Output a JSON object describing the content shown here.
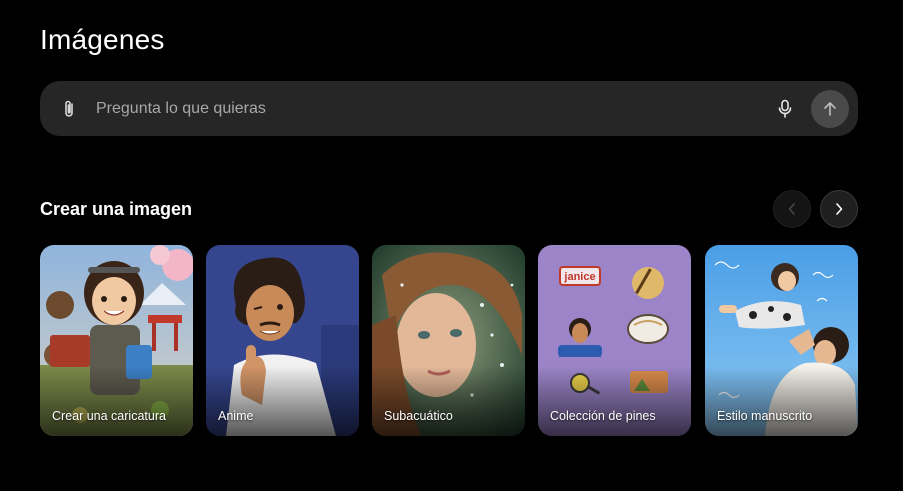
{
  "page": {
    "title": "Imágenes"
  },
  "prompt": {
    "placeholder": "Pregunta lo que quieras",
    "value": "",
    "attach_icon": "paperclip-icon",
    "mic_icon": "microphone-icon",
    "send_icon": "arrow-up-icon"
  },
  "section": {
    "title": "Crear una imagen",
    "prev_icon": "chevron-left-icon",
    "next_icon": "chevron-right-icon"
  },
  "cards": [
    {
      "label": "Crear una caricatura",
      "pin_text": ""
    },
    {
      "label": "Anime",
      "pin_text": ""
    },
    {
      "label": "Subacuático",
      "pin_text": ""
    },
    {
      "label": "Colección de pines",
      "pin_text": "janice"
    },
    {
      "label": "Estilo manuscrito",
      "pin_text": ""
    }
  ],
  "colors": {
    "background": "#000000",
    "prompt_bar": "#262626",
    "send_button": "#4a4a4a",
    "text_primary": "#ffffff",
    "text_placeholder": "#a8a8a8",
    "pin_card_bg": "#9b84c8",
    "handwritten_card_bg": "#5aa6e6",
    "anime_card_bg": "#35468f"
  }
}
